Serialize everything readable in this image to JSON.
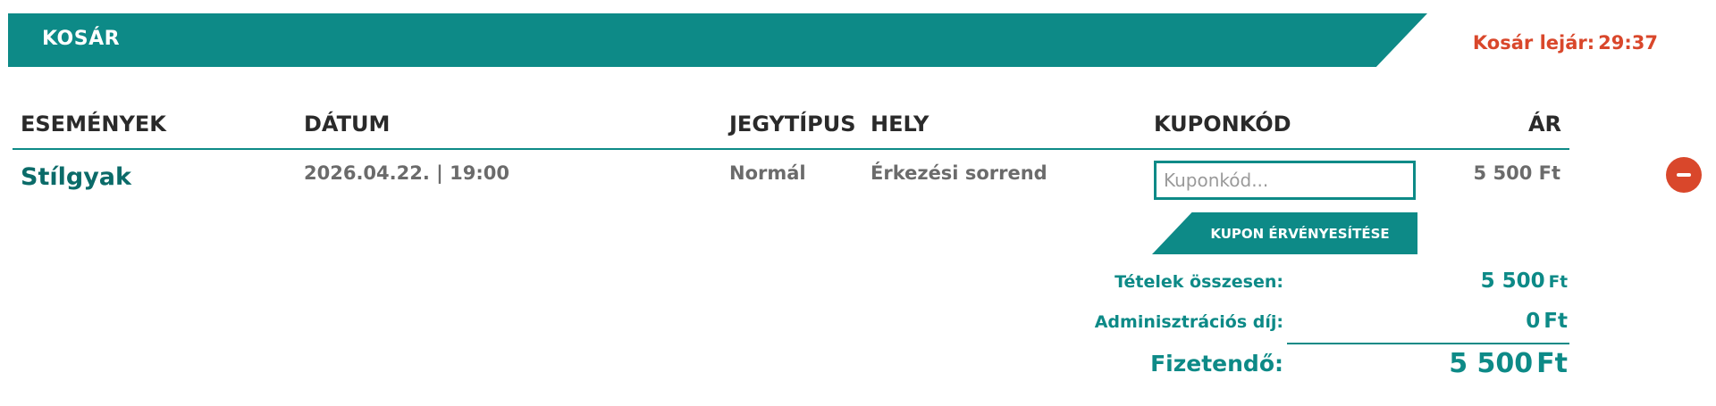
{
  "header": {
    "title": "KOSÁR",
    "timer_label": "Kosár lejár:",
    "timer_value": "29:37"
  },
  "columns": {
    "events": "ESEMÉNYEK",
    "date": "DÁTUM",
    "ticket_type": "JEGYTÍPUS",
    "place": "HELY",
    "coupon": "KUPONKÓD",
    "price": "ÁR"
  },
  "item": {
    "event": "Stílgyak",
    "date": "2026.04.22. | 19:00",
    "ticket_type": "Normál",
    "place": "Érkezési sorrend",
    "price": "5 500 Ft"
  },
  "coupon": {
    "value": "",
    "placeholder": "Kuponkód...",
    "button_label": "KUPON ÉRVÉNYESÍTÉSE"
  },
  "summary": {
    "items_total_label": "Tételek összesen:",
    "items_total_value": "5 500",
    "admin_fee_label": "Adminisztrációs díj:",
    "admin_fee_value": "0",
    "payable_label": "Fizetendő:",
    "payable_value": "5 500",
    "currency": "Ft"
  },
  "colors": {
    "accent": "#0d8a87",
    "alert": "#d9472b"
  },
  "icons": {
    "remove": "minus-circle-icon"
  }
}
